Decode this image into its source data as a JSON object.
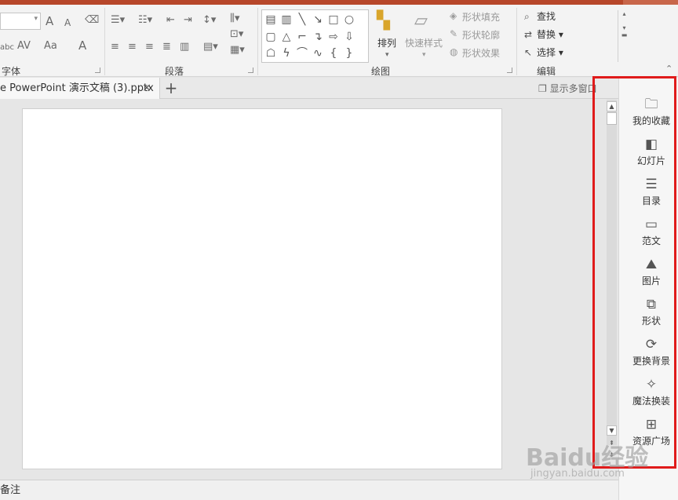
{
  "ribbon": {
    "groups": {
      "font": "字体",
      "paragraph": "段落",
      "drawing": "绘图",
      "editing": "编辑"
    },
    "drawing": {
      "arrange": "排列",
      "quick_styles": "快速样式",
      "shape_fill": "形状填充",
      "shape_outline": "形状轮廓",
      "shape_effects": "形状效果"
    },
    "editing": {
      "find": "查找",
      "replace": "替换",
      "select": "选择"
    },
    "font_tools": {
      "grow": "A",
      "shrink": "A",
      "spacing": "AV",
      "case": "Aa",
      "color": "A",
      "strike_sample": "abc"
    }
  },
  "tabs": {
    "document": "e PowerPoint 演示文稿 (3).pptx",
    "close": "×",
    "add": "+",
    "multi_window": "显示多窗口"
  },
  "notes": {
    "label": "备注"
  },
  "side_panel": {
    "items": [
      {
        "label": "我的收藏",
        "icon": "folder-heart-icon"
      },
      {
        "label": "幻灯片",
        "icon": "slides-icon"
      },
      {
        "label": "目录",
        "icon": "list-icon"
      },
      {
        "label": "范文",
        "icon": "document-icon"
      },
      {
        "label": "图片",
        "icon": "image-icon"
      },
      {
        "label": "形状",
        "icon": "shapes-icon"
      },
      {
        "label": "更换背景",
        "icon": "refresh-icon"
      },
      {
        "label": "魔法换装",
        "icon": "magic-wand-icon"
      },
      {
        "label": "资源广场",
        "icon": "grid-icon"
      }
    ]
  },
  "watermark": {
    "brand": "Baidu经验",
    "url": "jingyan.baidu.com"
  },
  "colors": {
    "title_accent": "#b7472a",
    "highlight_frame": "#e01b1b"
  }
}
